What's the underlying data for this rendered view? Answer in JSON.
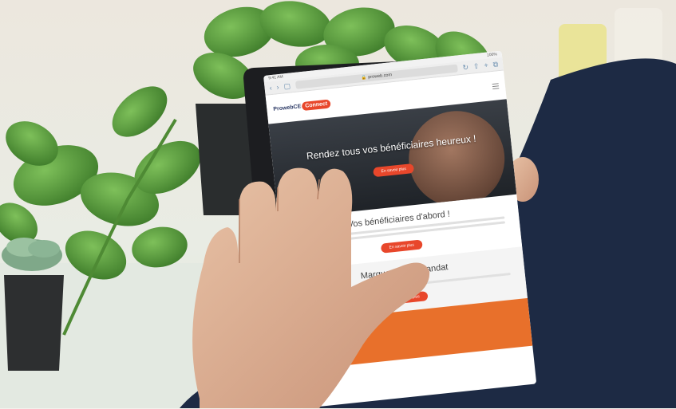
{
  "browser": {
    "url": "proweb.com",
    "nav_back": "‹",
    "nav_forward": "›",
    "status_time": "9:41 AM",
    "status_battery": "100%"
  },
  "site": {
    "logo_word": "ProwebCE",
    "logo_badge": "Connect",
    "hero_title": "Rendez tous vos bénéficiaires heureux !",
    "hero_cta": "En savoir plus",
    "section1_title": "Vos bénéficiaires d'abord !",
    "section1_cta": "En savoir plus",
    "section2_title": "Marquez votre mandat",
    "section2_cta": "En savoir plus"
  },
  "colors": {
    "brand_orange": "#e8472b",
    "brand_navy": "#2c3a66",
    "leaf_green": "#5a9a3c",
    "jacket": "#1d2a44"
  }
}
